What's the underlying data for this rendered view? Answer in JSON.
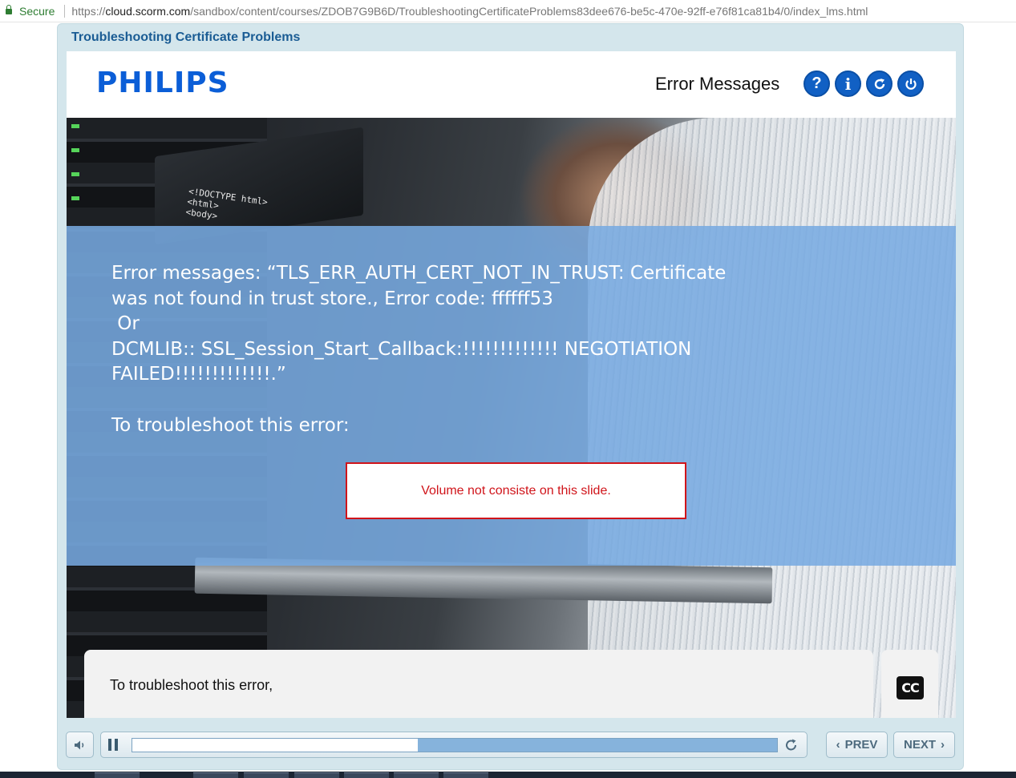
{
  "browser": {
    "secure_label": "Secure",
    "url_scheme": "https://",
    "url_host": "cloud.scorm.com",
    "url_path": "/sandbox/content/courses/ZDOB7G9B6D/TroubleshootingCertificateProblems83dee676-be5c-470e-92ff-e76f81ca81b4/0/index_lms.html"
  },
  "player": {
    "title": "Troubleshooting Certificate Problems"
  },
  "slide": {
    "logo": "PHILIPS",
    "heading": "Error Messages",
    "header_buttons": [
      {
        "name": "help",
        "icon": "question-icon"
      },
      {
        "name": "info",
        "icon": "info-icon"
      },
      {
        "name": "refresh",
        "icon": "refresh-icon"
      },
      {
        "name": "exit",
        "icon": "power-icon"
      }
    ],
    "laptop_code": "<!DOCTYPE html>\n<html>\n<body>",
    "message_lines": [
      "Error messages: “TLS_ERR_AUTH_CERT_NOT_IN_TRUST: Certificate",
      "was not found in trust store., Error code: ffffff53",
      " Or",
      "DCMLIB:: SSL_Session_Start_Callback:!!!!!!!!!!!!! NEGOTIATION",
      "FAILED!!!!!!!!!!!!!.”"
    ],
    "troubleshoot_line": "To troubleshoot this error:",
    "notice": "Volume not consiste on this slide."
  },
  "caption": {
    "text": "To troubleshoot this error,",
    "cc_label": "CC"
  },
  "controls": {
    "progress_fraction": 0.443,
    "prev_label": "PREV",
    "next_label": "NEXT"
  },
  "colors": {
    "accent": "#1160c4",
    "brand": "#0b5ed7",
    "notice": "#d0141a",
    "overlay": "#78aae1"
  }
}
